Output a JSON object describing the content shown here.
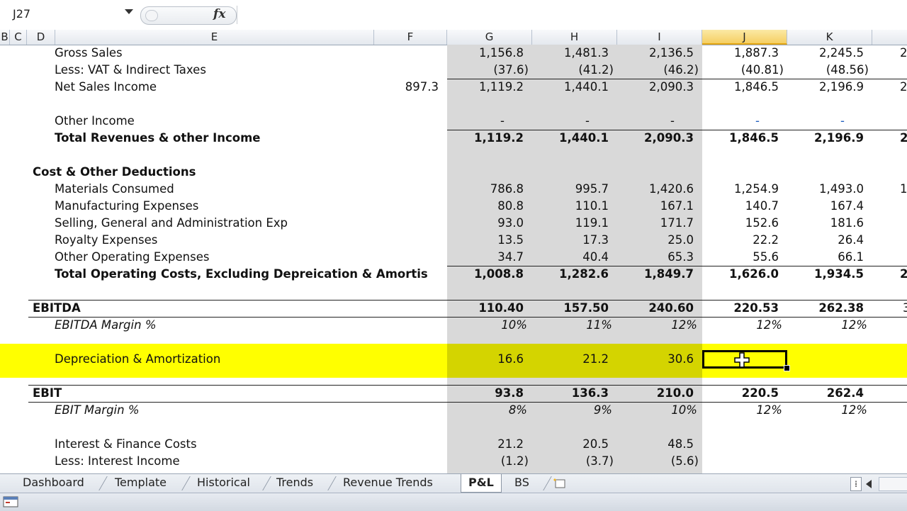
{
  "formula_bar": {
    "name_box": "J27",
    "fx_label": "fx",
    "formula": ""
  },
  "columns": [
    {
      "id": "B_partial",
      "label": "B"
    },
    {
      "id": "C",
      "label": "C"
    },
    {
      "id": "D",
      "label": "D"
    },
    {
      "id": "E",
      "label": "E"
    },
    {
      "id": "F",
      "label": "F"
    },
    {
      "id": "G",
      "label": "G"
    },
    {
      "id": "H",
      "label": "H"
    },
    {
      "id": "I",
      "label": "I"
    },
    {
      "id": "J",
      "label": "J",
      "selected": true
    },
    {
      "id": "K",
      "label": "K"
    }
  ],
  "rows": [
    {
      "label": "Gross Sales",
      "F": "",
      "G": "1,156.8",
      "H": "1,481.3",
      "I": "2,136.5",
      "J": "1,887.3",
      "K": "2,245.5",
      "L": "2"
    },
    {
      "label": "Less: VAT & Indirect Taxes",
      "F": "",
      "G": "(37.6)",
      "H": "(41.2)",
      "I": "(46.2)",
      "J": "(40.81)",
      "K": "(48.56)",
      "L": ""
    },
    {
      "label": "Net Sales Income",
      "F": "897.3",
      "G": "1,119.2",
      "H": "1,440.1",
      "I": "2,090.3",
      "J": "1,846.5",
      "K": "2,196.9",
      "L": "2"
    },
    {
      "label": "",
      "F": "",
      "G": "",
      "H": "",
      "I": "",
      "J": "",
      "K": "",
      "L": ""
    },
    {
      "label": "Other Income",
      "F": "",
      "G": "-",
      "H": "-",
      "I": "-",
      "J": "-",
      "K": "-",
      "L": ""
    },
    {
      "label": "Total Revenues & other Income",
      "F": "",
      "G": "1,119.2",
      "H": "1,440.1",
      "I": "2,090.3",
      "J": "1,846.5",
      "K": "2,196.9",
      "L": "2"
    },
    {
      "label": "",
      "F": "",
      "G": "",
      "H": "",
      "I": "",
      "J": "",
      "K": "",
      "L": ""
    },
    {
      "label": "Cost & Other Deductions",
      "F": "",
      "G": "",
      "H": "",
      "I": "",
      "J": "",
      "K": "",
      "L": ""
    },
    {
      "label": "Materials Consumed",
      "F": "",
      "G": "786.8",
      "H": "995.7",
      "I": "1,420.6",
      "J": "1,254.9",
      "K": "1,493.0",
      "L": "1"
    },
    {
      "label": "Manufacturing Expenses",
      "F": "",
      "G": "80.8",
      "H": "110.1",
      "I": "167.1",
      "J": "140.7",
      "K": "167.4",
      "L": ""
    },
    {
      "label": "Selling, General and Administration Exp",
      "F": "",
      "G": "93.0",
      "H": "119.1",
      "I": "171.7",
      "J": "152.6",
      "K": "181.6",
      "L": ""
    },
    {
      "label": "Royalty Expenses",
      "F": "",
      "G": "13.5",
      "H": "17.3",
      "I": "25.0",
      "J": "22.2",
      "K": "26.4",
      "L": ""
    },
    {
      "label": "Other Operating Expenses",
      "F": "",
      "G": "34.7",
      "H": "40.4",
      "I": "65.3",
      "J": "55.6",
      "K": "66.1",
      "L": ""
    },
    {
      "label": "Total Operating Costs, Excluding Depreication & Amortis",
      "F": "",
      "G": "1,008.8",
      "H": "1,282.6",
      "I": "1,849.7",
      "J": "1,626.0",
      "K": "1,934.5",
      "L": "2"
    },
    {
      "label": "",
      "F": "",
      "G": "",
      "H": "",
      "I": "",
      "J": "",
      "K": "",
      "L": ""
    },
    {
      "label": "EBITDA",
      "F": "",
      "G": "110.40",
      "H": "157.50",
      "I": "240.60",
      "J": "220.53",
      "K": "262.38",
      "L": "3"
    },
    {
      "label": "EBITDA Margin %",
      "F": "",
      "G": "10%",
      "H": "11%",
      "I": "12%",
      "J": "12%",
      "K": "12%",
      "L": ""
    },
    {
      "label": "",
      "F": "",
      "G": "",
      "H": "",
      "I": "",
      "J": "",
      "K": "",
      "L": ""
    },
    {
      "label": "Depreciation & Amortization",
      "F": "",
      "G": "16.6",
      "H": "21.2",
      "I": "30.6",
      "J": "",
      "K": "",
      "L": ""
    },
    {
      "label": "",
      "F": "",
      "G": "",
      "H": "",
      "I": "",
      "J": "",
      "K": "",
      "L": ""
    },
    {
      "label": "EBIT",
      "F": "",
      "G": "93.8",
      "H": "136.3",
      "I": "210.0",
      "J": "220.5",
      "K": "262.4",
      "L": ""
    },
    {
      "label": "EBIT Margin %",
      "F": "",
      "G": "8%",
      "H": "9%",
      "I": "10%",
      "J": "12%",
      "K": "12%",
      "L": ""
    },
    {
      "label": "",
      "F": "",
      "G": "",
      "H": "",
      "I": "",
      "J": "",
      "K": "",
      "L": ""
    },
    {
      "label": "Interest & Finance Costs",
      "F": "",
      "G": "21.2",
      "H": "20.5",
      "I": "48.5",
      "J": "",
      "K": "",
      "L": ""
    },
    {
      "label": "Less: Interest Income",
      "F": "",
      "G": "(1.2)",
      "H": "(3.7)",
      "I": "(5.6)",
      "J": "",
      "K": "",
      "L": ""
    }
  ],
  "sheet_tabs": [
    "Dashboard",
    "Template",
    "Historical",
    "Trends",
    "Revenue Trends",
    "P&L",
    "BS"
  ],
  "active_sheet": "P&L",
  "colors": {
    "highlight": "#ffff00",
    "shade": "#d9d9d9",
    "selected_header": "#f5cf63",
    "blue_dash": "#1f5fbf"
  }
}
